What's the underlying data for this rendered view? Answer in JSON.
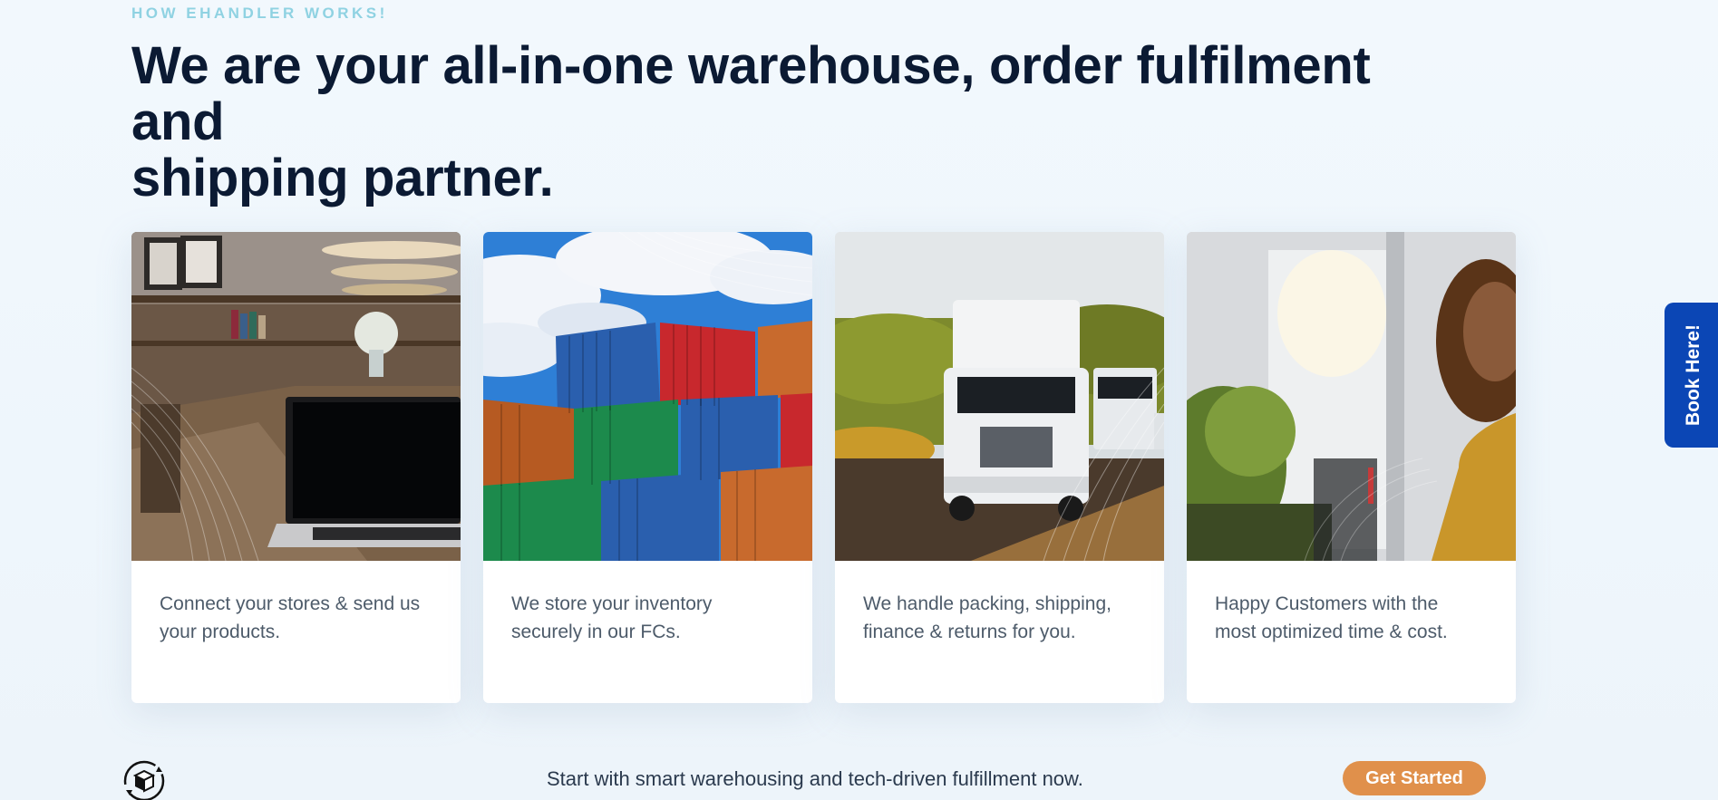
{
  "section": {
    "eyebrow": "HOW EHANDLER WORKS!",
    "headline_line1": "We are your all-in-one warehouse, order fulfilment and",
    "headline_line2": "shipping partner."
  },
  "cards": [
    {
      "text_line1": "Connect your stores & send us",
      "text_line2": "your products.",
      "image": "laptop-on-desk-image"
    },
    {
      "text_line1": "We store your inventory",
      "text_line2": "securely in our FCs.",
      "image": "shipping-containers-image"
    },
    {
      "text_line1": "We handle packing, shipping,",
      "text_line2": "finance & returns for you.",
      "image": "delivery-trucks-image"
    },
    {
      "text_line1": "Happy Customers with the",
      "text_line2": "most optimized time & cost.",
      "image": "smiling-customer-image"
    }
  ],
  "cta": {
    "text": "Start with smart warehousing and tech-driven fulfillment now.",
    "button_label": "Get Started",
    "icon": "package-cycle-icon"
  },
  "side_tab": {
    "label": "Book Here!"
  },
  "colors": {
    "accent_orange": "#e0904b",
    "tab_blue": "#0b46b5",
    "headline": "#0b1a33",
    "eyebrow": "#8fd2e2"
  }
}
